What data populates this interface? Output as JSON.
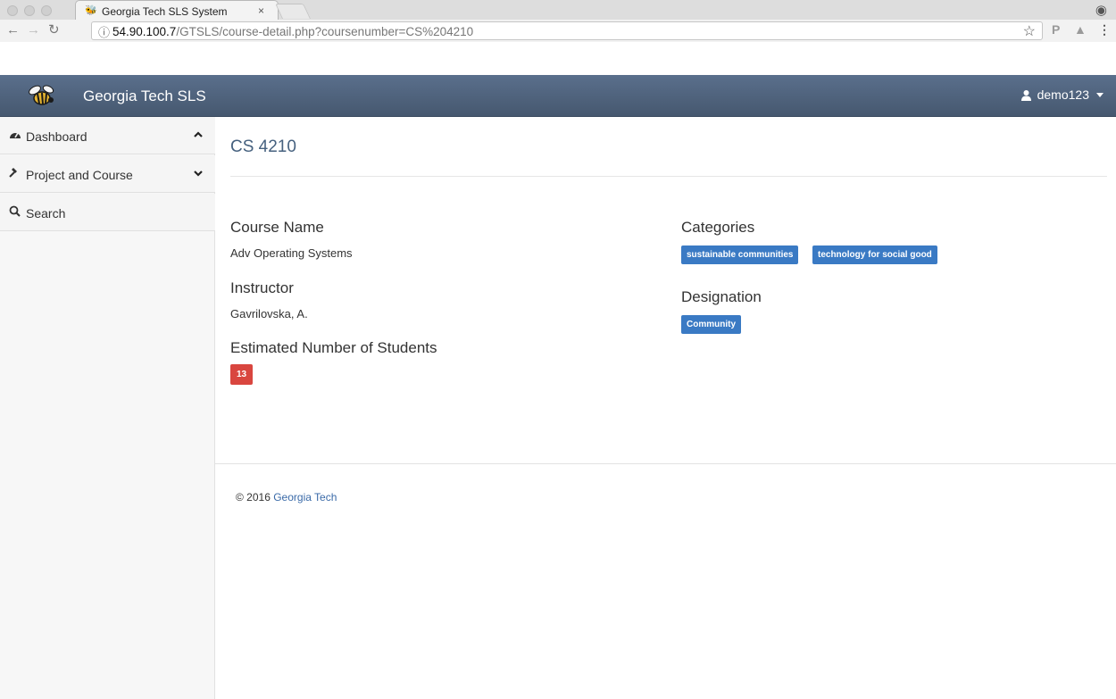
{
  "browser": {
    "tab_title": "Georgia Tech SLS System",
    "tab_close": "×",
    "url_host": "54.90.100.7",
    "url_path": "/GTSLS/course-detail.php?coursenumber=CS%204210"
  },
  "navbar": {
    "brand": "Georgia Tech SLS",
    "username": "demo123"
  },
  "sidebar": {
    "items": [
      {
        "label": "Dashboard",
        "icon": "dashboard-icon",
        "chevron": "up"
      },
      {
        "label": "Project and Course",
        "icon": "gavel-icon",
        "chevron": "down"
      },
      {
        "label": "Search",
        "icon": "search-icon"
      }
    ]
  },
  "course": {
    "number": "CS 4210",
    "name_label": "Course Name",
    "name": "Adv Operating Systems",
    "instructor_label": "Instructor",
    "instructor": "Gavrilovska, A.",
    "students_label": "Estimated Number of Students",
    "students": "13",
    "categories_label": "Categories",
    "categories": [
      "sustainable communities",
      "technology for social good"
    ],
    "designation_label": "Designation",
    "designation": "Community"
  },
  "footer": {
    "copyright": "© 2016",
    "link": "Georgia Tech"
  },
  "colors": {
    "navbar": "#4f637e",
    "title": "#46617f",
    "badge_blue": "#3a7ac4",
    "badge_red": "#d9463f"
  }
}
